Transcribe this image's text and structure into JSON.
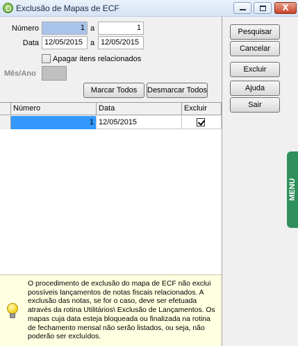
{
  "window": {
    "title": "Exclusão de Mapas de ECF",
    "controls": {
      "close_glyph": "X"
    }
  },
  "form": {
    "numero_label": "Número",
    "numero_from": "1",
    "a_label_1": "a",
    "numero_to": "1",
    "data_label": "Data",
    "data_from": "12/05/2015",
    "a_label_2": "a",
    "data_to": "12/05/2015",
    "apagar_label": "Apagar itens relacionados",
    "mes_ano_label": "Mês/Ano",
    "mes_ano_value": ""
  },
  "buttons": {
    "marcar_todos": "Marcar Todos",
    "desmarcar_todos": "Desmarcar Todos",
    "pesquisar": "Pesquisar",
    "cancelar": "Cancelar",
    "excluir": "Excluir",
    "ajuda": "Ajuda",
    "sair": "Sair"
  },
  "grid": {
    "columns": [
      "Número",
      "Data",
      "Excluir"
    ],
    "rows": [
      {
        "numero": "1",
        "data": "12/05/2015",
        "excluir": true
      }
    ]
  },
  "info": {
    "icon": "lightbulb-icon",
    "text": "O procedimento de exclusão do mapa de ECF não exclui possíveis lançamentos de notas fiscais relacionados. A exclusão das notas, se for o caso, deve ser efetuada através da rotina Utilitários\\ Exclusão de Lançamentos. Os mapas cuja data esteja bloqueada ou finalizada na rotina de fechamento mensal não serão listados, ou seja, não poderão ser excluídos."
  },
  "side_tab": {
    "label": "MENU",
    "color": "#2f8f5b"
  },
  "colors": {
    "selection": "#3399ff",
    "info_background": "#ffffe1",
    "window_background": "#f0f0f0"
  }
}
